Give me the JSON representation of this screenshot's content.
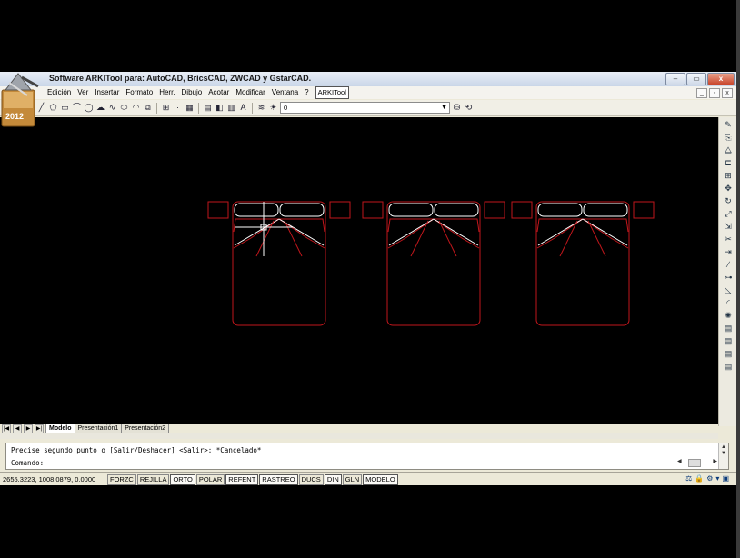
{
  "window": {
    "title": "Software ARKITool para: AutoCAD, BricsCAD, ZWCAD y GstarCAD.",
    "logo_year": "2012",
    "buttons": {
      "minimize": "–",
      "restore": "▭",
      "close": "x"
    }
  },
  "menubar": {
    "items": [
      "Edición",
      "Ver",
      "Insertar",
      "Formato",
      "Herr.",
      "Dibujo",
      "Acotar",
      "Modificar",
      "Ventana",
      "?"
    ],
    "plugin": "ARKITool",
    "mdi": {
      "minimize": "_",
      "restore": "▫",
      "close": "x"
    }
  },
  "toolbar": {
    "layer_value": "0"
  },
  "tabs": {
    "nav": [
      "|◀",
      "◀",
      "▶",
      "▶|"
    ],
    "items": [
      "Modelo",
      "Presentación1",
      "Presentación2"
    ],
    "active": "Modelo"
  },
  "command": {
    "history": "Precise segundo punto o [Salir/Deshacer] <Salir>: *Cancelado*",
    "prompt": "Comando:"
  },
  "status": {
    "coords": "2655.3223, 1008.0879, 0.0000",
    "toggles": [
      {
        "label": "FORZC",
        "on": false
      },
      {
        "label": "REJILLA",
        "on": false
      },
      {
        "label": "ORTO",
        "on": true
      },
      {
        "label": "POLAR",
        "on": false
      },
      {
        "label": "REFENT",
        "on": true
      },
      {
        "label": "RASTREO",
        "on": true
      },
      {
        "label": "DUCS",
        "on": false
      },
      {
        "label": "DIN",
        "on": true
      },
      {
        "label": "GLN",
        "on": false
      },
      {
        "label": "MODELO",
        "on": true
      }
    ]
  },
  "colors": {
    "canvas": "#000000",
    "bed_outline": "#c0161b",
    "pillow": "#ffffff",
    "crosshair": "#ffffff"
  },
  "icons": {
    "draw_toolbar": [
      "line-icon",
      "polygon-icon",
      "rectangle-icon",
      "arc-icon",
      "circle-icon",
      "cloud-icon",
      "spline-icon",
      "ellipse-icon",
      "ellipse-arc-icon",
      "insert-block-icon",
      "make-block-icon",
      "point-icon",
      "hatch-icon",
      "gradient-icon",
      "region-icon",
      "table-icon",
      "mtext-icon"
    ],
    "modify_toolbar": [
      "erase-icon",
      "copy-icon",
      "mirror-icon",
      "offset-icon",
      "array-icon",
      "move-icon",
      "rotate-icon",
      "scale-icon",
      "stretch-icon",
      "trim-icon",
      "extend-icon",
      "break-icon",
      "join-icon",
      "chamfer-icon",
      "fillet-icon",
      "explode-icon"
    ]
  }
}
